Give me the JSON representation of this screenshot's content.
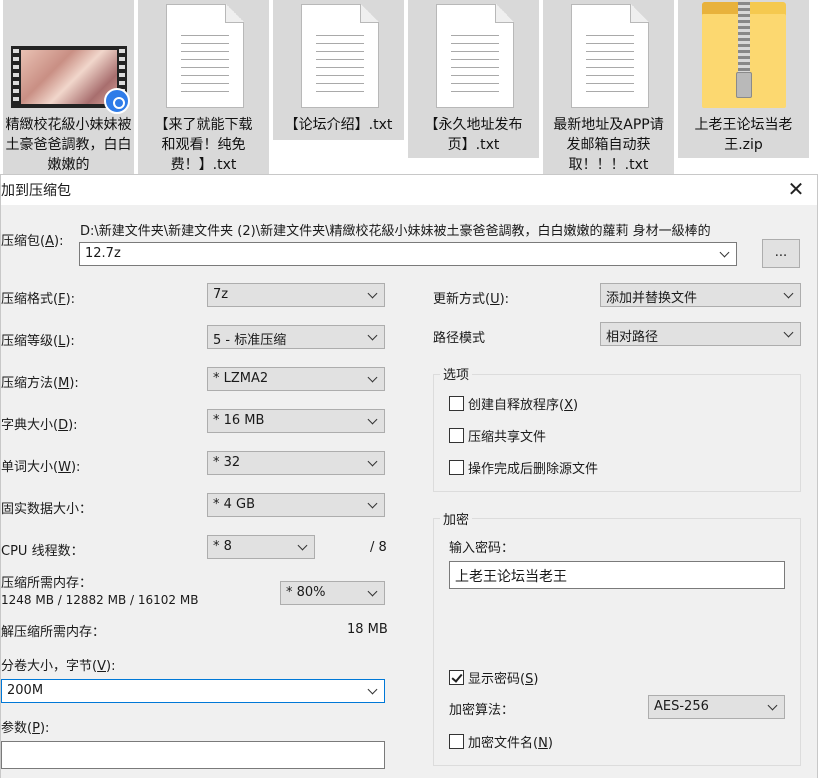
{
  "files": [
    {
      "name": "精緻校花級小妹妹被土豪爸爸調教，白白嫩嫩的",
      "kind": "video"
    },
    {
      "name": "【来了就能下载和观看！纯免费！】.txt",
      "kind": "text"
    },
    {
      "name": "【论坛介绍】.txt",
      "kind": "text"
    },
    {
      "name": "【永久地址发布页】.txt",
      "kind": "text"
    },
    {
      "name": "最新地址及APP请发邮箱自动获取！！！.txt",
      "kind": "text"
    },
    {
      "name": "上老王论坛当老王.zip",
      "kind": "zip"
    }
  ],
  "dialog": {
    "title": "加到压缩包",
    "archive_label": "压缩包",
    "archive_key": "A",
    "archive_path": "D:\\新建文件夹\\新建文件夹 (2)\\新建文件夹\\精緻校花級小妹妹被土豪爸爸調教，白白嫩嫩的蘿莉 身材一級棒的",
    "archive_name": "12.7z",
    "browse_label": "...",
    "format": {
      "label": "压缩格式",
      "key": "F",
      "value": "7z"
    },
    "level": {
      "label": "压缩等级",
      "key": "L",
      "value": "5 - 标准压缩"
    },
    "method": {
      "label": "压缩方法",
      "key": "M",
      "value": "* LZMA2"
    },
    "dict": {
      "label": "字典大小",
      "key": "D",
      "value": "* 16 MB"
    },
    "word": {
      "label": "单词大小",
      "key": "W",
      "value": "* 32"
    },
    "solid": {
      "label": "固实数据大小：",
      "value": "* 4 GB"
    },
    "cpu": {
      "label": "CPU 线程数：",
      "value": "* 8",
      "total": "/ 8"
    },
    "mem": {
      "label": "压缩所需内存：",
      "detail": "1248 MB / 12882 MB / 16102 MB",
      "value": "* 80%"
    },
    "unmem": {
      "label": "解压缩所需内存：",
      "value": "18 MB"
    },
    "volume": {
      "label": "分卷大小，字节",
      "key": "V",
      "value": "200M"
    },
    "params": {
      "label": "参数",
      "key": "P",
      "value": ""
    },
    "update": {
      "label": "更新方式",
      "key": "U",
      "value": "添加并替换文件"
    },
    "path_mode": {
      "label": "路径模式",
      "value": "相对路径"
    },
    "options": {
      "title": "选项",
      "sfx": {
        "label": "创建自释放程序",
        "key": "X",
        "checked": false
      },
      "shared": {
        "label": "压缩共享文件",
        "checked": false
      },
      "delete": {
        "label": "操作完成后删除源文件",
        "checked": false
      }
    },
    "encryption": {
      "title": "加密",
      "password_label": "输入密码：",
      "password": "上老王论坛当老王",
      "show_label": "显示密码",
      "show_key": "S",
      "show_checked": true,
      "algo_label": "加密算法：",
      "algo": "AES-256",
      "names_label": "加密文件名",
      "names_key": "N",
      "names_checked": false
    }
  }
}
